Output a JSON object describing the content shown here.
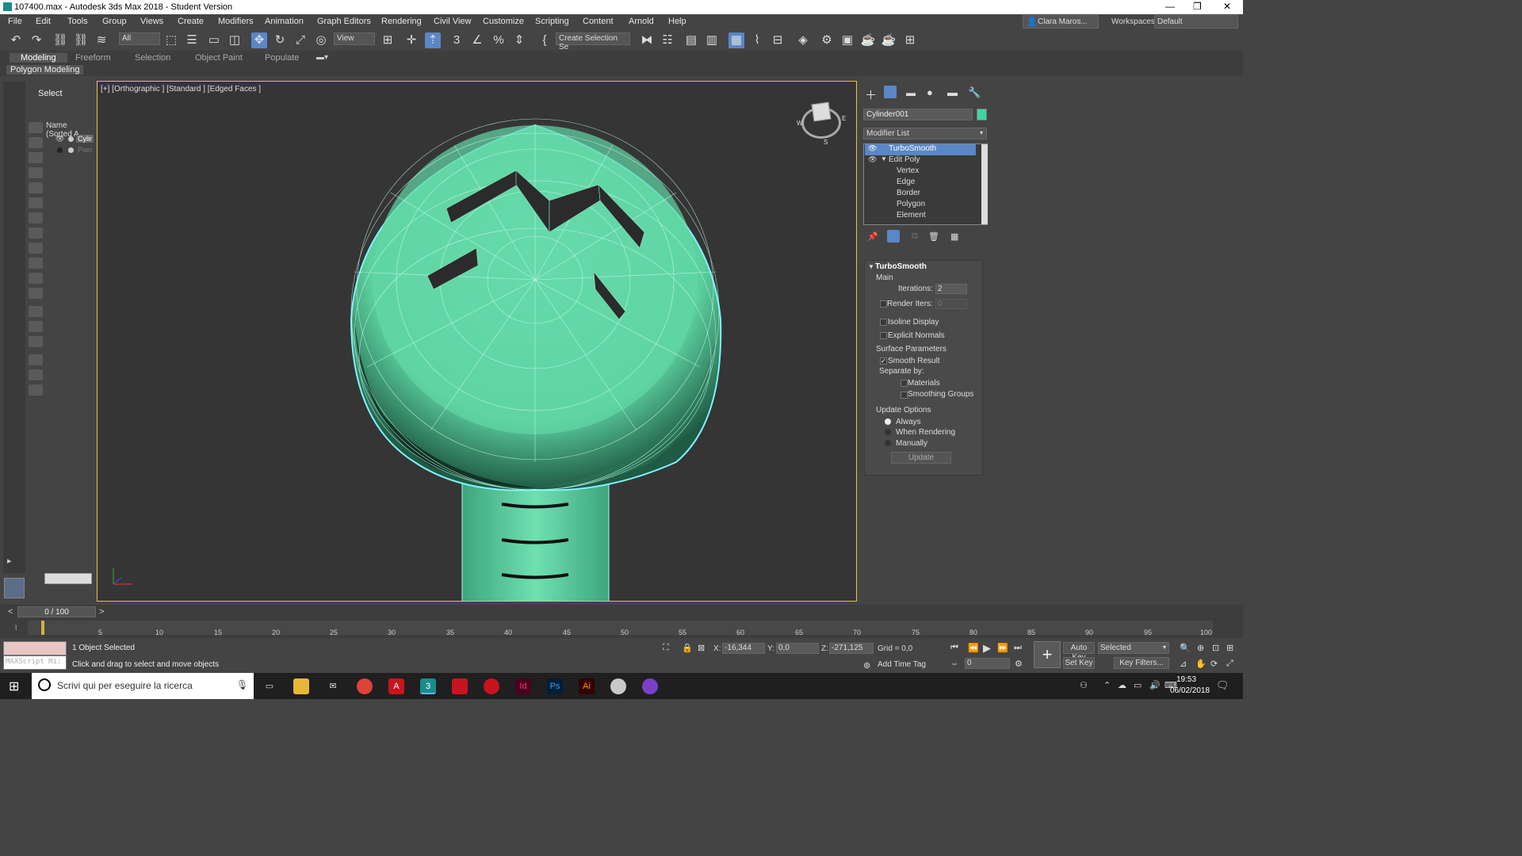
{
  "window": {
    "title": "107400.max - Autodesk 3ds Max 2018 - Student Version"
  },
  "menu": [
    "File",
    "Edit",
    "Tools",
    "Group",
    "Views",
    "Create",
    "Modifiers",
    "Animation",
    "Graph Editors",
    "Rendering",
    "Civil View",
    "Customize",
    "Scripting",
    "Content",
    "Arnold",
    "Help"
  ],
  "user": {
    "name": "Clara Maros...",
    "workspaces_label": "Workspaces:",
    "workspace": "Default"
  },
  "toolbar": {
    "filter": "All",
    "ref_coord": "View",
    "selection_set": "Create Selection Se"
  },
  "ribbon": {
    "tabs": [
      "Modeling",
      "Freeform",
      "Selection",
      "Object Paint",
      "Populate"
    ],
    "sub": "Polygon Modeling"
  },
  "scene_explorer": {
    "title": "Select",
    "column": "Name (Sorted A",
    "items": [
      "Cylir",
      "Plan"
    ]
  },
  "viewport": {
    "label": "[+] [Orthographic ] [Standard ] [Edged Faces ]",
    "compass": [
      "W",
      "E",
      "S"
    ]
  },
  "command_panel": {
    "object_name": "Cylinder001",
    "object_color": "#3dd6a0",
    "modifier_list_label": "Modifier List",
    "stack": [
      "TurboSmooth",
      "Edit Poly",
      "Vertex",
      "Edge",
      "Border",
      "Polygon",
      "Element"
    ],
    "rollup": {
      "title": "TurboSmooth",
      "main_label": "Main",
      "iterations_label": "Iterations:",
      "iterations": "2",
      "render_iters_label": "Render Iters:",
      "render_iters": "0",
      "isoline": "Isoline Display",
      "explicit_normals": "Explicit Normals",
      "surface_label": "Surface Parameters",
      "smooth_result": "Smooth Result",
      "separate_by": "Separate by:",
      "materials": "Materials",
      "smoothing_groups": "Smoothing Groups",
      "update_options": "Update Options",
      "always": "Always",
      "when_rendering": "When Rendering",
      "manually": "Manually",
      "update_button": "Update"
    }
  },
  "timeline": {
    "frame": "0 / 100",
    "ticks": [
      "5",
      "10",
      "15",
      "20",
      "25",
      "30",
      "35",
      "40",
      "45",
      "50",
      "55",
      "60",
      "65",
      "70",
      "75",
      "80",
      "85",
      "90",
      "95",
      "100"
    ]
  },
  "status": {
    "selected": "1 Object Selected",
    "prompt": "Click and drag to select and move objects",
    "maxscript": "MAXScript Mi:",
    "x_label": "X:",
    "x": "-16,344",
    "y_label": "Y:",
    "y": "0,0",
    "z_label": "Z:",
    "z": "-271,125",
    "grid": "Grid = 0,0",
    "add_time_tag": "Add Time Tag",
    "auto_key": "Auto Key",
    "set_key": "Set Key",
    "selected_dropdown": "Selected",
    "key_filters": "Key Filters...",
    "frame_field": "0"
  },
  "taskbar": {
    "search_placeholder": "Scrivi qui per eseguire la ricerca",
    "time": "19:53",
    "date": "06/02/2018"
  }
}
